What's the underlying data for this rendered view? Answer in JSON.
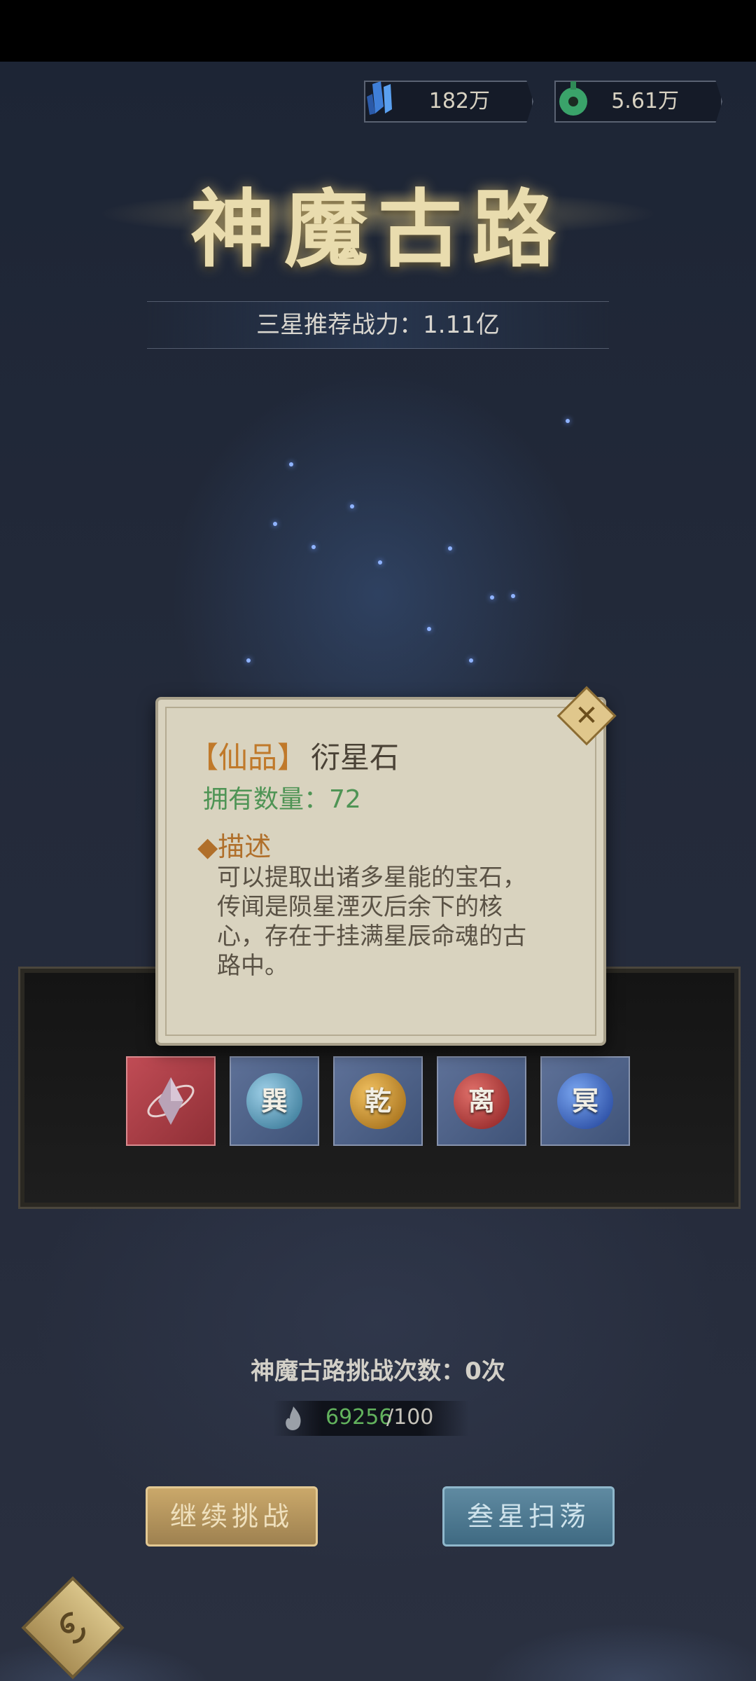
{
  "currency": {
    "crystal_value": "182万",
    "jade_value": "5.61万",
    "crystal_icon": "blue-crystal-icon",
    "jade_icon": "green-jade-icon"
  },
  "header": {
    "title": "神魔古路",
    "recommended_power": "三星推荐战力：1.11亿"
  },
  "popup": {
    "grade": "【仙品】",
    "item_name": "衍星石",
    "owned_label": "拥有数量：72",
    "desc_heading": "◆描述",
    "desc_text": "可以提取出诸多星能的宝石，传闻是陨星湮灭后余下的核心，存在于挂满星辰命魂的古路中。",
    "close_glyph": "✕"
  },
  "rewards": [
    {
      "icon": "star-stone-crystal-icon",
      "glyph": ""
    },
    {
      "icon": "xun-orb-icon",
      "glyph": "巽"
    },
    {
      "icon": "qian-orb-icon",
      "glyph": "乾"
    },
    {
      "icon": "li-orb-icon",
      "glyph": "离"
    },
    {
      "icon": "ming-orb-icon",
      "glyph": "冥"
    }
  ],
  "challenge": {
    "attempts_label": "神魔古路挑战次数：0次",
    "energy_current": "69256",
    "energy_max": "/100"
  },
  "buttons": {
    "continue_label": "继续挑战",
    "sweep_label": "叁星扫荡"
  },
  "colors": {
    "gold_accent": "#c0792a",
    "green_count": "#4f9455",
    "energy_green": "#62b25d"
  }
}
